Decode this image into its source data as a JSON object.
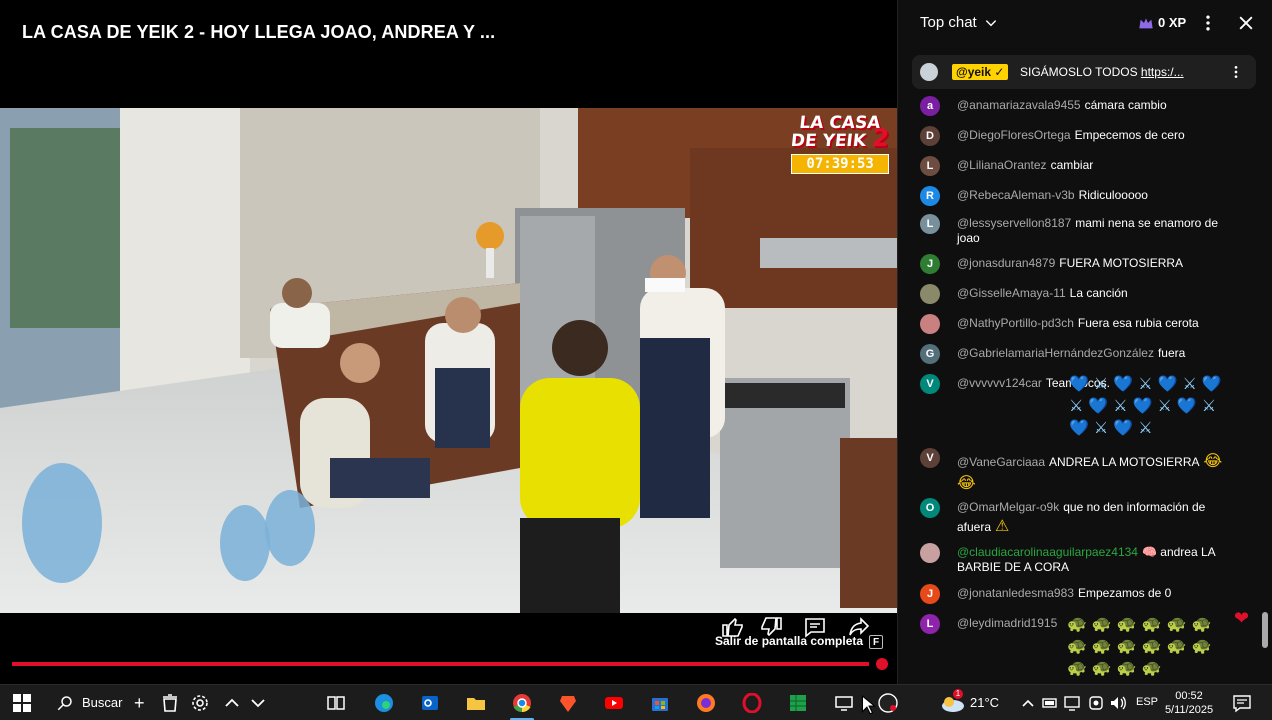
{
  "video": {
    "title": "LA CASA DE YEIK 2 -  HOY LLEGA JOAO, ANDREA Y ...",
    "overlay_logo_line1": "LA CASA",
    "overlay_logo_line2": "DE YEIK",
    "overlay_logo_num": "2",
    "overlay_clock": "07:39:53",
    "fullscreen_tip": "Salir de pantalla completa",
    "fullscreen_key": "F",
    "progress_fraction": 0.985
  },
  "chat": {
    "title": "Top chat",
    "xp": "0 XP",
    "pinned": {
      "author": "@yeik",
      "text": "SIGÁMOSLO TODOS ",
      "link": "https:/..."
    },
    "messages": [
      {
        "avatar": "a",
        "color": "#7b1fa2",
        "author": "@anamariazavala9455",
        "text": "cámara cambio"
      },
      {
        "avatar": "D",
        "color": "#5d4037",
        "author": "@DiegoFloresOrtega",
        "text": "Empecemos de cero"
      },
      {
        "avatar": "L",
        "color": "#6d4c41",
        "author": "@LilianaOrantez",
        "text": "cambiar"
      },
      {
        "avatar": "R",
        "color": "#1e88e5",
        "author": "@RebecaAleman-v3b",
        "text": "Ridiculooooo"
      },
      {
        "avatar": "L",
        "color": "#78909c",
        "author": "@lessyservellon8187",
        "text": "mami nena se enamoro de joao"
      },
      {
        "avatar": "J",
        "color": "#2e7d32",
        "author": "@jonasduran4879",
        "text": "FUERA MOTOSIERRA"
      },
      {
        "avatar": "",
        "color": "#8a8a6a",
        "author": "@GisselleAmaya-11",
        "text": "La canción"
      },
      {
        "avatar": "",
        "color": "#c98080",
        "author": "@NathyPortillo-pd3ch",
        "text": "Fuera esa rubia cerota"
      },
      {
        "avatar": "G",
        "color": "#546e7a",
        "author": "@GabrielamariaHernándezGonzález",
        "text": "fuera"
      },
      {
        "avatar": "V",
        "color": "#00897b",
        "author": "@vvvvvv124car",
        "text": "Team locos."
      },
      {
        "avatar": "V",
        "color": "#5d4037",
        "author": "@VaneGarciaaa",
        "text": "ANDREA LA MOTOSIERRA"
      },
      {
        "avatar": "O",
        "color": "#00897b",
        "author": "@OmarMelgar-o9k",
        "text": "que no den información de afuera"
      },
      {
        "avatar": "",
        "color": "#c9a0a0",
        "author": "@claudiacarolinaaguilarpaez4134",
        "text": "andrea LA BARBIE DE A CORA"
      },
      {
        "avatar": "J",
        "color": "#e64a19",
        "author": "@jonatanledesma983",
        "text": "Empezamos de 0"
      },
      {
        "avatar": "L",
        "color": "#8e24aa",
        "author": "@leydimadrid1915",
        "text": ""
      }
    ]
  },
  "taskbar": {
    "search_label": "Buscar",
    "temperature": "21°C",
    "language": "ESP",
    "time": "00:52",
    "date": "5/11/2025",
    "weather_badge": "1"
  }
}
